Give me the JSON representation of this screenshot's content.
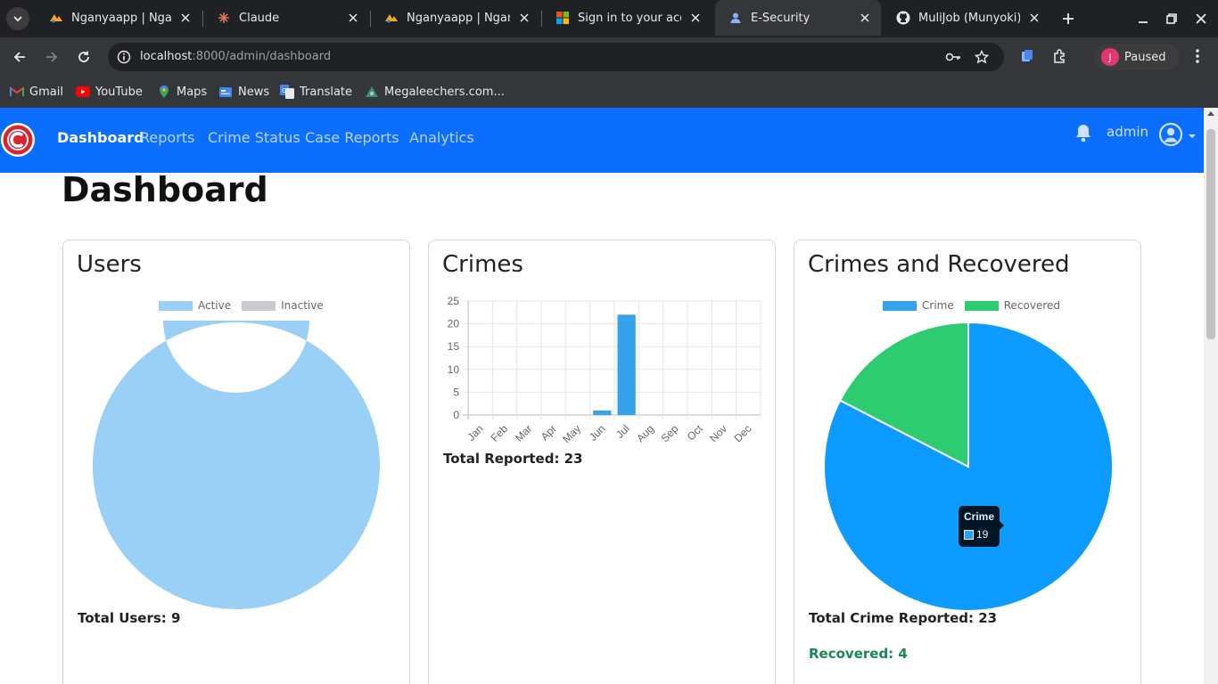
{
  "browser": {
    "tabs": [
      {
        "title": "Nganyaapp | Nganya",
        "active": false
      },
      {
        "title": "Claude",
        "active": false
      },
      {
        "title": "Nganyaapp | Nganya",
        "active": false
      },
      {
        "title": "Sign in to your acco",
        "active": false
      },
      {
        "title": "E-Security",
        "active": true
      },
      {
        "title": "MuliJob (Munyoki)",
        "active": false
      }
    ],
    "url_host": "localhost",
    "url_path": ":8000/admin/dashboard",
    "profile_initial": "J",
    "profile_status": "Paused",
    "bookmarks": [
      "Gmail",
      "YouTube",
      "Maps",
      "News",
      "Translate",
      "Megaleechers.com..."
    ]
  },
  "nav": {
    "links": [
      "Dashboard",
      "Reports",
      "Crime Status",
      "Case Reports",
      "Analytics"
    ],
    "active": "Dashboard",
    "user": "admin"
  },
  "page": {
    "title": "Dashboard"
  },
  "cards": {
    "users": {
      "title": "Users",
      "legend": [
        "Active",
        "Inactive"
      ],
      "total": "Total Users: 9"
    },
    "crimes": {
      "title": "Crimes",
      "total": "Total Reported: 23"
    },
    "recovered": {
      "title": "Crimes and Recovered",
      "legend": [
        "Crime",
        "Recovered"
      ],
      "total": "Total Crime Reported: 23",
      "recovered": "Recovered: 4",
      "tooltip_title": "Crime",
      "tooltip_value": "19"
    }
  },
  "colors": {
    "navbar": "#0b6efd",
    "active_users": "#9ad0f5",
    "inactive_users": "#c9cbcf",
    "bar": "#36a2eb",
    "crime": "#0d9bff",
    "recovered": "#2ecc71"
  },
  "chart_data": [
    {
      "type": "pie",
      "variant": "doughnut",
      "labels": [
        "Active",
        "Inactive"
      ],
      "values": [
        9,
        0
      ]
    },
    {
      "type": "bar",
      "categories": [
        "Jan",
        "Feb",
        "Mar",
        "Apr",
        "May",
        "Jun",
        "Jul",
        "Aug",
        "Sep",
        "Oct",
        "Nov",
        "Dec"
      ],
      "values": [
        0,
        0,
        0,
        0,
        0,
        1,
        22,
        0,
        0,
        0,
        0,
        0
      ],
      "ylim": [
        0,
        25
      ],
      "yticks": [
        0,
        5,
        10,
        15,
        20,
        25
      ],
      "grid": true
    },
    {
      "type": "pie",
      "labels": [
        "Crime",
        "Recovered"
      ],
      "values": [
        19,
        4
      ]
    }
  ]
}
